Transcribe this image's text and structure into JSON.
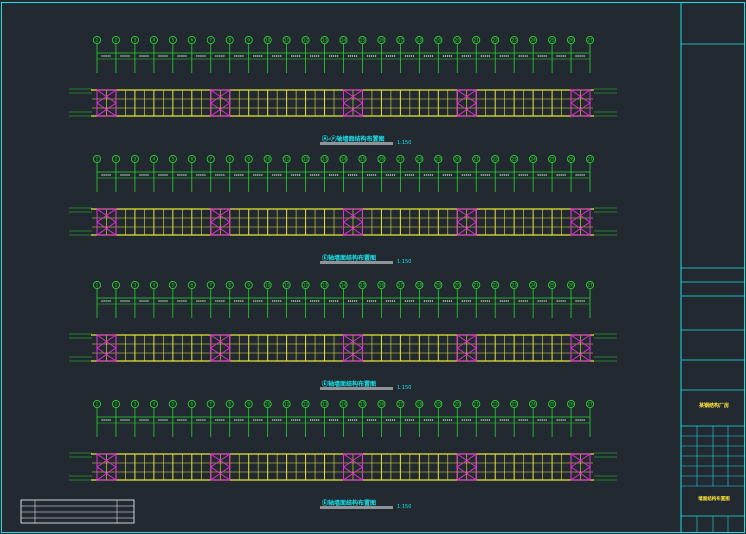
{
  "sheet": {
    "background": "#222931",
    "border_color": "#19e0e6",
    "axis_color": "#26d62a",
    "purlin_color": "#e6e63a",
    "brace_color": "#e42fd6",
    "dim_color": "#dfe8e8"
  },
  "axis_labels": [
    "1",
    "2",
    "3",
    "4",
    "5",
    "6",
    "7",
    "8",
    "9",
    "10",
    "11",
    "12",
    "13",
    "14",
    "15",
    "16",
    "17",
    "18",
    "19",
    "20",
    "21",
    "22",
    "23",
    "24",
    "25",
    "26",
    "27"
  ],
  "braced_bays": [
    0,
    6,
    13,
    19,
    25
  ],
  "elevations": [
    {
      "title": "Ⓐ-Ⓕ轴墙面结构布置图",
      "scale": "1:150"
    },
    {
      "title": "Ⓔ轴墙面结构布置图",
      "scale": "1:150"
    },
    {
      "title": "Ⓔ轴墙面结构布置图",
      "scale": "1:150"
    },
    {
      "title": "Ⓔ轴墙面结构布置图",
      "scale": "1:150"
    }
  ],
  "title_block": {
    "project": "某钢结构厂房",
    "drawing": "墙面结构布置图"
  }
}
